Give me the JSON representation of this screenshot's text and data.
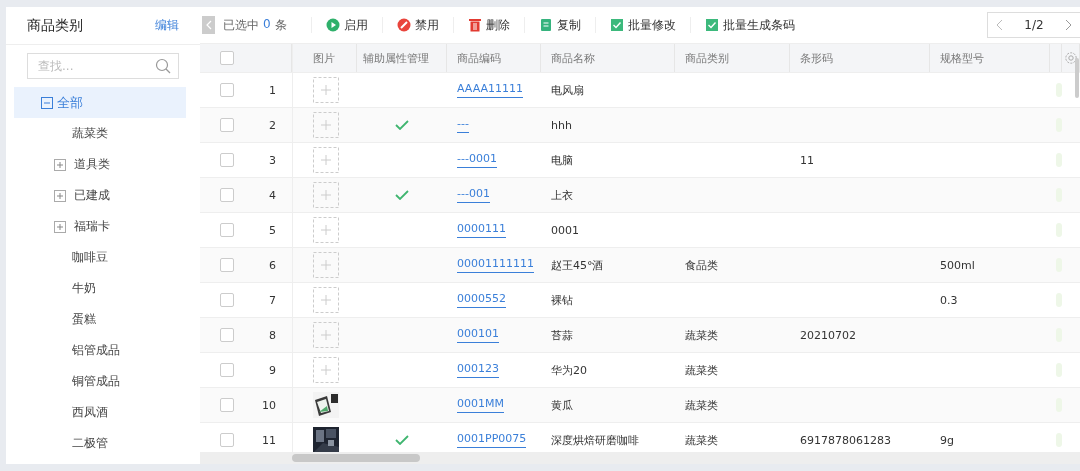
{
  "sidebar": {
    "title": "商品类别",
    "edit_link": "编辑",
    "search": {
      "placeholder": "查找..."
    },
    "tree": [
      {
        "kind": "group",
        "label": "全部",
        "selected": true,
        "expanded": true,
        "children": [
          {
            "kind": "leaf",
            "label": "蔬菜类",
            "selected": false
          },
          {
            "kind": "group",
            "label": "道具类",
            "selected": false,
            "expanded": false
          },
          {
            "kind": "group",
            "label": "已建成",
            "selected": false,
            "expanded": false
          },
          {
            "kind": "group",
            "label": "福瑞卡",
            "selected": false,
            "expanded": false
          },
          {
            "kind": "leaf",
            "label": "咖啡豆",
            "selected": false
          },
          {
            "kind": "leaf",
            "label": "牛奶",
            "selected": false
          },
          {
            "kind": "leaf",
            "label": "蛋糕",
            "selected": false
          },
          {
            "kind": "leaf",
            "label": "铝管成品",
            "selected": false
          },
          {
            "kind": "leaf",
            "label": "铜管成品",
            "selected": false
          },
          {
            "kind": "leaf",
            "label": "西凤酒",
            "selected": false
          },
          {
            "kind": "leaf",
            "label": "二极管",
            "selected": false
          }
        ]
      }
    ]
  },
  "toolbar": {
    "selection_prefix": "已选中",
    "selection_count": "0",
    "selection_suffix": "条",
    "buttons": [
      {
        "kind": "enable",
        "label": "启用"
      },
      {
        "kind": "disable",
        "label": "禁用"
      },
      {
        "kind": "delete",
        "label": "删除"
      },
      {
        "kind": "copy",
        "label": "复制"
      },
      {
        "kind": "batch",
        "label": "批量修改"
      },
      {
        "kind": "batch",
        "label": "批量生成条码"
      }
    ],
    "pagination": "1/2"
  },
  "table": {
    "all_checked": false,
    "columns": [
      "图片",
      "辅助属性管理",
      "商品编码",
      "商品名称",
      "商品类别",
      "条形码",
      "规格型号"
    ],
    "rows": [
      {
        "index": "1",
        "checked": false,
        "kind": "placeholder",
        "aux": false,
        "code": "AAAA11111",
        "name": "电风扇",
        "category": "",
        "barcode": "",
        "spec": ""
      },
      {
        "index": "2",
        "checked": false,
        "kind": "placeholder",
        "aux": true,
        "code": "---",
        "name": "hhh",
        "category": "",
        "barcode": "",
        "spec": ""
      },
      {
        "index": "3",
        "checked": false,
        "kind": "placeholder",
        "aux": false,
        "code": "---0001",
        "name": "电脑",
        "category": "",
        "barcode": "11",
        "spec": ""
      },
      {
        "index": "4",
        "checked": false,
        "kind": "placeholder",
        "aux": true,
        "code": "---001",
        "name": "上衣",
        "category": "",
        "barcode": "",
        "spec": ""
      },
      {
        "index": "5",
        "checked": false,
        "kind": "placeholder",
        "aux": false,
        "code": "0000111",
        "name": "0001",
        "category": "",
        "barcode": "",
        "spec": ""
      },
      {
        "index": "6",
        "checked": false,
        "kind": "placeholder",
        "aux": false,
        "code": "00001111111",
        "name": "赵王45°酒",
        "category": "食品类",
        "barcode": "",
        "spec": "500ml"
      },
      {
        "index": "7",
        "checked": false,
        "kind": "placeholder",
        "aux": false,
        "code": "0000552",
        "name": "裸钻",
        "category": "",
        "barcode": "",
        "spec": "0.3"
      },
      {
        "index": "8",
        "checked": false,
        "kind": "placeholder",
        "aux": false,
        "code": "000101",
        "name": "苔蒜",
        "category": "蔬菜类",
        "barcode": "20210702",
        "spec": ""
      },
      {
        "index": "9",
        "checked": false,
        "kind": "placeholder",
        "aux": false,
        "code": "000123",
        "name": "华为20",
        "category": "蔬菜类",
        "barcode": "",
        "spec": ""
      },
      {
        "index": "10",
        "checked": false,
        "kind": "picture",
        "aux": false,
        "code": "0001MM",
        "name": "黄瓜",
        "category": "蔬菜类",
        "barcode": "",
        "spec": ""
      },
      {
        "index": "11",
        "checked": false,
        "kind": "picture",
        "aux": true,
        "code": "0001PP0075",
        "name": "深度烘焙研磨咖啡",
        "category": "蔬菜类",
        "barcode": "6917878061283",
        "spec": "9g"
      }
    ]
  }
}
